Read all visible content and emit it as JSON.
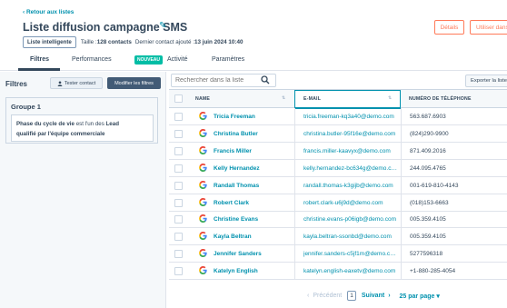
{
  "header": {
    "back_label": "Retour aux listes",
    "title": "Liste diffusion campagne SMS",
    "list_type": "Liste intelligente",
    "size_label": "Taille : ",
    "size_value": "128 contacts",
    "last_added_label": "Dernier contact ajouté : ",
    "last_added_value": "13 juin 2024 10:40",
    "details_button": "Détails",
    "use_button": "Utiliser dans"
  },
  "tabs": [
    {
      "label": "Filtres",
      "active": true
    },
    {
      "label": "Performances",
      "active": false
    },
    {
      "label": "Activité",
      "active": false,
      "badge": "NOUVEAU"
    },
    {
      "label": "Paramètres",
      "active": false
    }
  ],
  "filters_panel": {
    "title": "Filtres",
    "test_button": "Tester contact",
    "modify_button": "Modifier les filtres",
    "group_title": "Groupe 1",
    "rule": {
      "property": "Phase du cycle de vie",
      "operator": " est l'un des ",
      "value_a": "Lead",
      "value_b": "qualifié par l'équipe commerciale"
    }
  },
  "toolbar": {
    "search_placeholder": "Rechercher dans la liste",
    "export_button": "Exporter la liste"
  },
  "table": {
    "columns": [
      "NAME",
      "E-MAIL",
      "NUMÉRO DE TÉLÉPHONE"
    ],
    "rows": [
      {
        "name": "Tricia Freeman",
        "email": "tricia.freeman-kq3a40@demo.com",
        "phone": "563.687.6903"
      },
      {
        "name": "Christina Butler",
        "email": "christina.butler-95f16e@demo.com",
        "phone": "(824)290-9900"
      },
      {
        "name": "Francis Miller",
        "email": "francis.miller-kaavyx@demo.com",
        "phone": "871.409.2016"
      },
      {
        "name": "Kelly Hernandez",
        "email": "kelly.hernandez-bc634g@demo.com",
        "phone": "244.095.4765"
      },
      {
        "name": "Randall Thomas",
        "email": "randall.thomas-k3gijb@demo.com",
        "phone": "001-619-810-4143"
      },
      {
        "name": "Robert Clark",
        "email": "robert.clark-u6j9d@demo.com",
        "phone": "(018)153-6663"
      },
      {
        "name": "Christine Evans",
        "email": "christine.evans-p06igb@demo.com",
        "phone": "005.359.4105"
      },
      {
        "name": "Kayla Beltran",
        "email": "kayla.beltran-ssonbd@demo.com",
        "phone": "005.359.4105"
      },
      {
        "name": "Jennifer Sanders",
        "email": "jennifer.sanders-c5jf1m@demo.com",
        "phone": "5277596318"
      },
      {
        "name": "Katelyn English",
        "email": "katelyn.english-eaxetv@demo.com",
        "phone": "+1-880-285-4054"
      }
    ]
  },
  "pagination": {
    "prev": "Précédent",
    "page": "1",
    "next": "Suivant",
    "per_page": "25 par page"
  },
  "colors": {
    "accent": "#0091ae",
    "primary_button": "#425b76",
    "orange": "#ff7a59",
    "new_badge": "#00bda5"
  },
  "icons": [
    "chevron-left-icon",
    "pencil-icon",
    "person-icon",
    "search-icon",
    "sort-icon",
    "google-icon",
    "chevron-right-icon",
    "caret-down-icon"
  ]
}
